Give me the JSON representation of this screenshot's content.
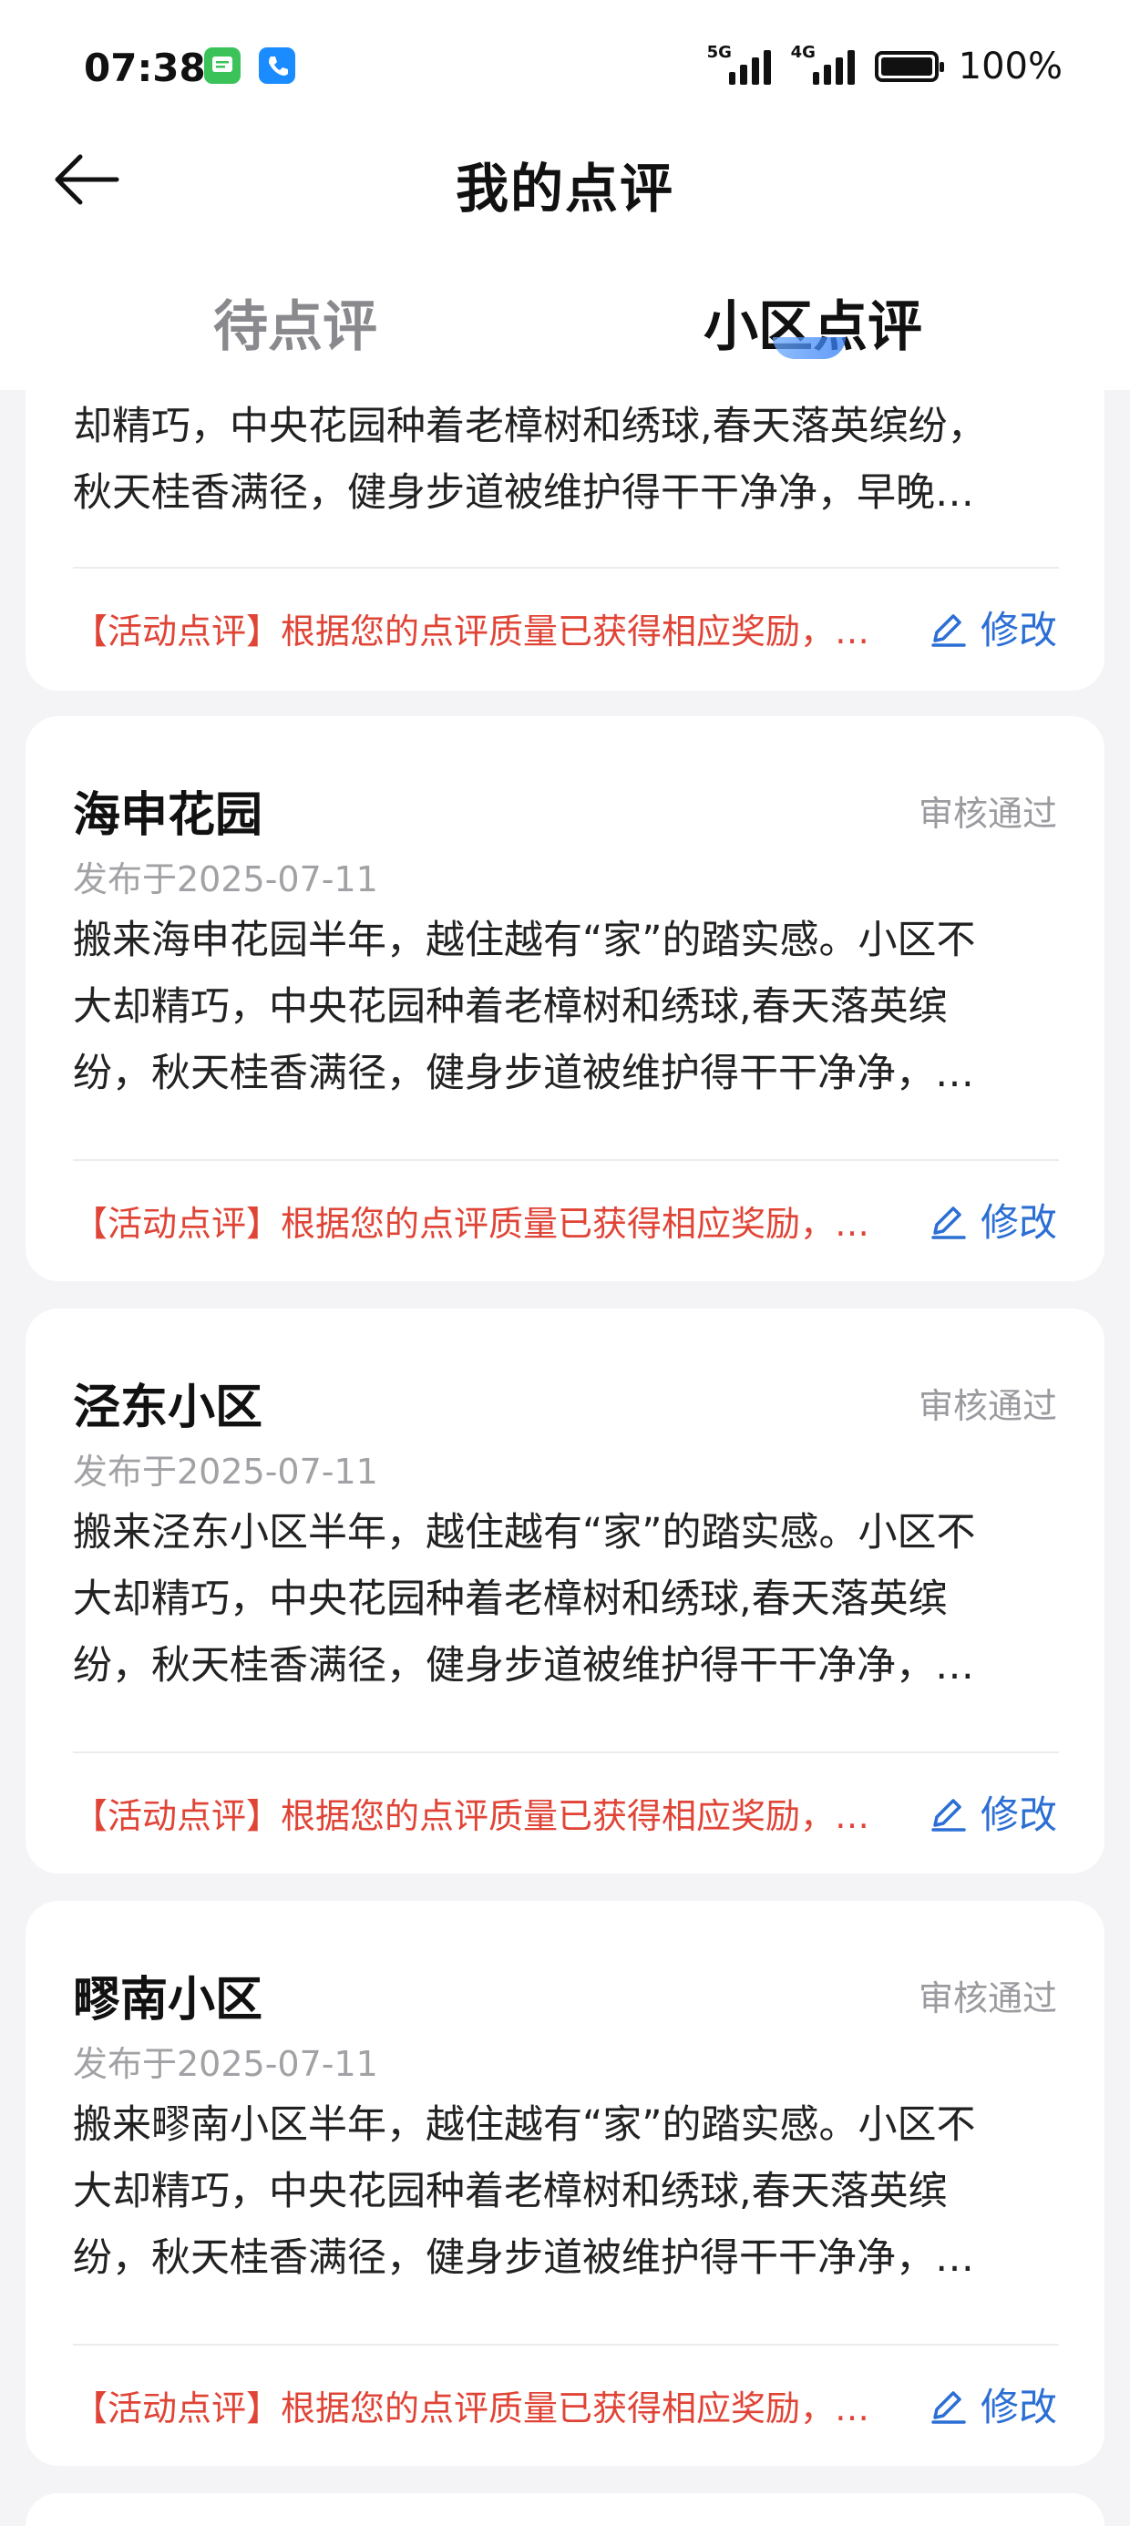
{
  "status_bar": {
    "time": "07:38",
    "signal1_label": "5G",
    "signal2_label": "4G",
    "battery": "100%",
    "colors": {
      "messages_icon": "#3bc35a",
      "phone_icon": "#1a8cff"
    }
  },
  "header": {
    "title": "我的点评",
    "back_icon": "arrow-left-icon"
  },
  "tabs": [
    {
      "label": "待点评",
      "active": false
    },
    {
      "label": "小区点评",
      "active": true
    }
  ],
  "colors": {
    "reward": "#e04436",
    "accent": "#2b6ed4",
    "muted": "#9a9a9f"
  },
  "cards": [
    {
      "body": "却精巧，中央花园种着老樟树和绣球,春天落英缤纷，\n秋天桂香满径，健身步道被维护得干干净净，早晚…",
      "reward": "【活动点评】根据您的点评质量已获得相应奖励，…",
      "edit": "修改"
    },
    {
      "title": "海申花园",
      "status": "审核通过",
      "date": "发布于2025-07-11",
      "body": "搬来海申花园半年，越住越有“家”的踏实感。小区不\n大却精巧，中央花园种着老樟树和绣球,春天落英缤\n纷，秋天桂香满径，健身步道被维护得干干净净，…",
      "reward": "【活动点评】根据您的点评质量已获得相应奖励，…",
      "edit": "修改"
    },
    {
      "title": "泾东小区",
      "status": "审核通过",
      "date": "发布于2025-07-11",
      "body": "搬来泾东小区半年，越住越有“家”的踏实感。小区不\n大却精巧，中央花园种着老樟树和绣球,春天落英缤\n纷，秋天桂香满径，健身步道被维护得干干净净，…",
      "reward": "【活动点评】根据您的点评质量已获得相应奖励，…",
      "edit": "修改"
    },
    {
      "title": "疁南小区",
      "status": "审核通过",
      "date": "发布于2025-07-11",
      "body": "搬来疁南小区半年，越住越有“家”的踏实感。小区不\n大却精巧，中央花园种着老樟树和绣球,春天落英缤\n纷，秋天桂香满径，健身步道被维护得干干净净，…",
      "reward": "【活动点评】根据您的点评质量已获得相应奖励，…",
      "edit": "修改"
    }
  ]
}
